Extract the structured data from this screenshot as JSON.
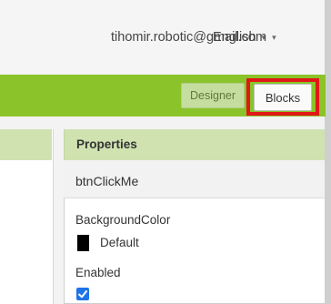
{
  "header": {
    "language": "English",
    "account": "tihomir.robotic@gmail.com"
  },
  "toolbar": {
    "designer_label": "Designer",
    "blocks_label": "Blocks"
  },
  "properties": {
    "title": "Properties",
    "component": "btnClickMe",
    "items": [
      {
        "label": "BackgroundColor",
        "value": "Default",
        "swatch": "#000000"
      },
      {
        "label": "Enabled",
        "checked": true
      }
    ]
  },
  "colors": {
    "accent_green": "#8ac32a",
    "highlight_red": "#e01818",
    "checkbox_blue": "#1e73e8"
  }
}
